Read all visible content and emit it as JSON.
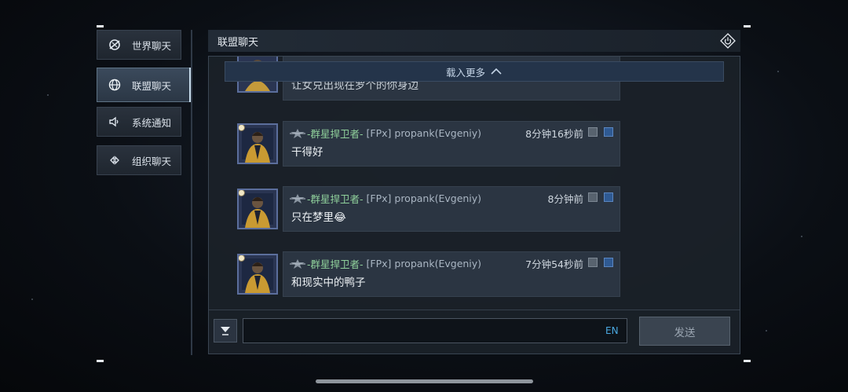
{
  "sidebar": {
    "items": [
      {
        "label": "世界聊天",
        "icon": "world-chat-icon",
        "active": false
      },
      {
        "label": "联盟聊天",
        "icon": "globe-icon",
        "active": true
      },
      {
        "label": "系统通知",
        "icon": "speaker-icon",
        "active": false
      },
      {
        "label": "组织聊天",
        "icon": "organization-icon",
        "active": false
      }
    ]
  },
  "header": {
    "title": "联盟聊天",
    "action_icon": "power-diamond-icon"
  },
  "chat": {
    "load_more_label": "载入更多",
    "partial_message_text": "让女兑出现在罗个的你身边",
    "messages": [
      {
        "alliance": "-群星捍卫者-",
        "username": "[FPx] propank(Evgeniy)",
        "time": "8分钟16秒前",
        "text": "干得好"
      },
      {
        "alliance": "-群星捍卫者-",
        "username": "[FPx] propank(Evgeniy)",
        "time": "8分钟前",
        "text": "只在梦里😂"
      },
      {
        "alliance": "-群星捍卫者-",
        "username": "[FPx] propank(Evgeniy)",
        "time": "7分钟54秒前",
        "text": "和现实中的鸭子"
      }
    ]
  },
  "composer": {
    "input_value": "",
    "language_label": "EN",
    "send_label": "发送"
  },
  "colors": {
    "alliance_name": "#8fd09b",
    "language_toggle": "#4aa8e0",
    "load_more_bg": "#24344a"
  }
}
